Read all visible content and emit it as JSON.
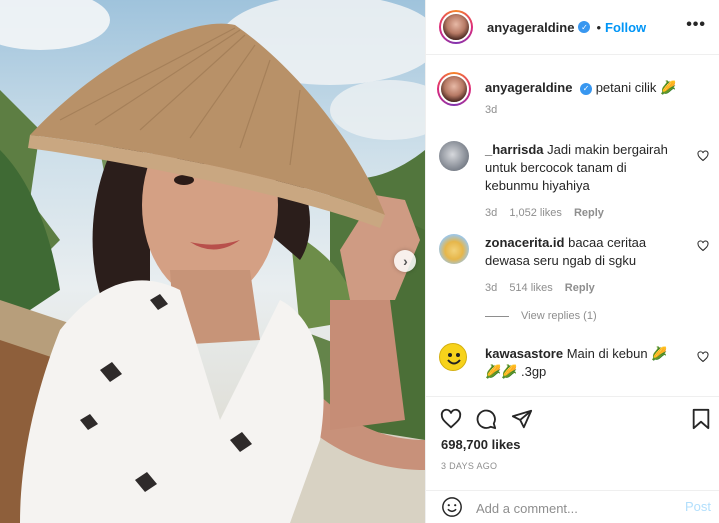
{
  "post": {
    "author": "anyageraldine",
    "separator": "•",
    "follow_label": "Follow",
    "more_label": "•••",
    "verified_glyph": "✓",
    "next_glyph": "›"
  },
  "caption": {
    "user": "anyageraldine",
    "text": "petani cilik 🌽",
    "time": "3d"
  },
  "comments": [
    {
      "user": "_harrisda",
      "text": "Jadi makin bergairah untuk bercocok tanam di kebunmu hiyahiya",
      "time": "3d",
      "likes": "1,052 likes",
      "reply_label": "Reply"
    },
    {
      "user": "zonacerita.id",
      "text": "bacaa ceritaa dewasa seru ngab di sgku",
      "time": "3d",
      "likes": "514 likes",
      "reply_label": "Reply"
    },
    {
      "user": "kawasastore",
      "text": "Main di kebun 🌽 🌽🌽 .3gp"
    }
  ],
  "view_replies_label": "View replies (1)",
  "stats": {
    "likes": "698,700 likes",
    "age": "3 DAYS AGO"
  },
  "composer": {
    "placeholder": "Add a comment...",
    "post_label": "Post"
  },
  "icons": {
    "heart": "heart-icon",
    "comment": "comment-icon",
    "share": "share-icon",
    "save": "bookmark-icon",
    "emoji": "emoji-icon",
    "next": "chevron-right-icon",
    "more": "more-options-icon"
  },
  "colors": {
    "accent": "#0095f6",
    "verified": "#3897f0",
    "muted": "#8e8e8e",
    "text": "#262626",
    "post_disabled": "#b2dffc"
  }
}
